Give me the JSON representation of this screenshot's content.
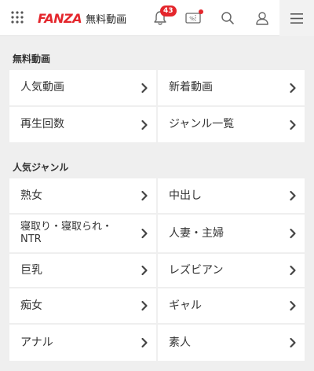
{
  "header": {
    "logo_brand": "FANZA",
    "logo_sub": "無料動画",
    "notification_count": "43",
    "coupon_glyph": "%"
  },
  "sections": [
    {
      "title": "無料動画",
      "items": [
        {
          "label": "人気動画"
        },
        {
          "label": "新着動画"
        },
        {
          "label": "再生回数"
        },
        {
          "label": "ジャンル一覧"
        }
      ]
    },
    {
      "title": "人気ジャンル",
      "items": [
        {
          "label": "熟女"
        },
        {
          "label": "中出し"
        },
        {
          "label": "寝取り・寝取られ・NTR"
        },
        {
          "label": "人妻・主婦"
        },
        {
          "label": "巨乳"
        },
        {
          "label": "レズビアン"
        },
        {
          "label": "痴女"
        },
        {
          "label": "ギャル"
        },
        {
          "label": "アナル"
        },
        {
          "label": "素人"
        }
      ]
    }
  ],
  "colors": {
    "brand": "#e4262c",
    "page_background": "#efefef",
    "cell_background": "#ffffff"
  },
  "icons": [
    "grid-menu-icon",
    "bell-icon",
    "coupon-icon",
    "search-icon",
    "user-icon",
    "hamburger-menu-icon",
    "chevron-right-icon"
  ]
}
